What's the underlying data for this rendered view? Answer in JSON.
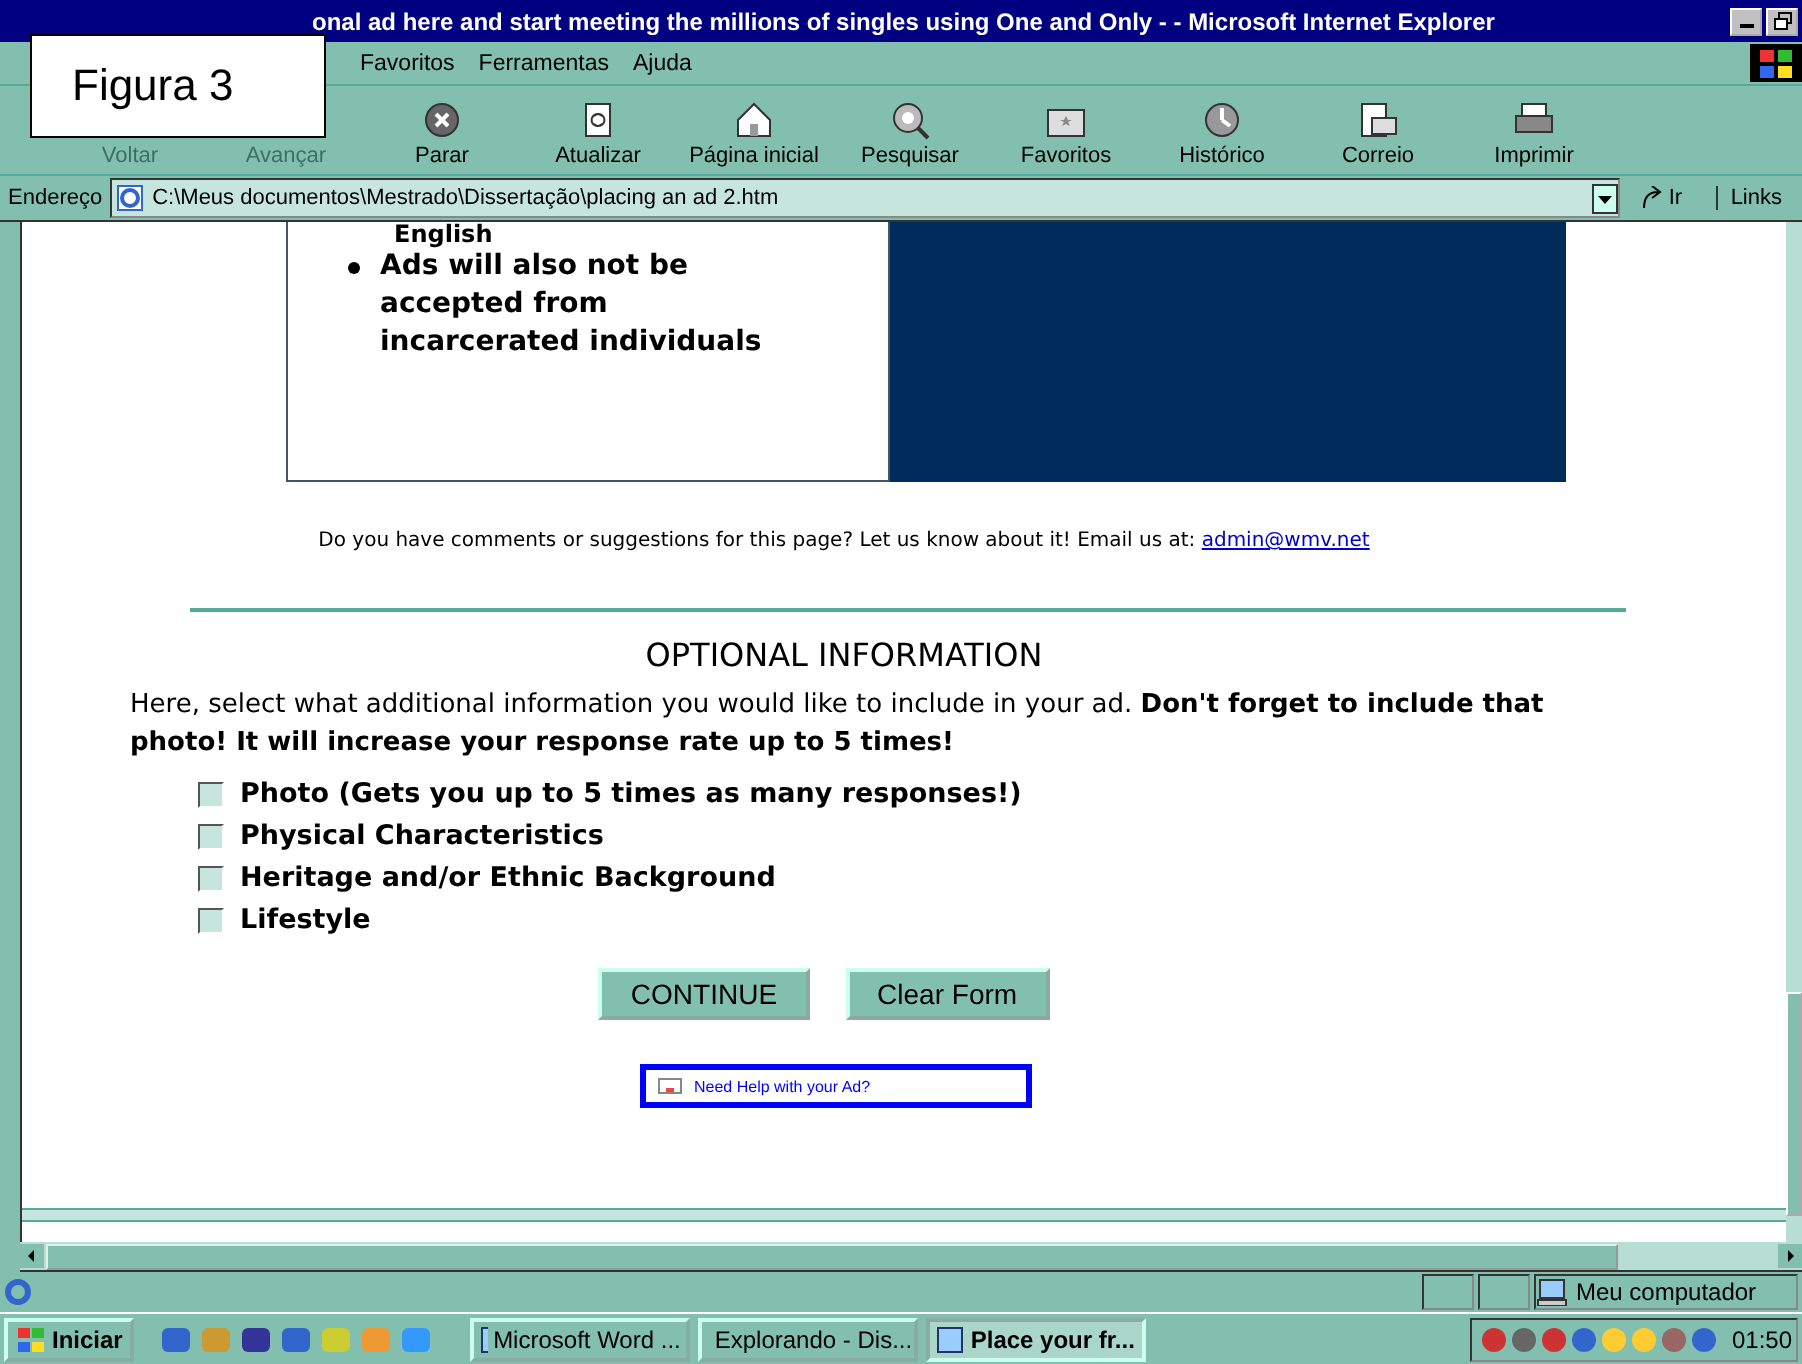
{
  "window": {
    "title": "onal ad here and start meeting the millions of singles using One and Only - - Microsoft Internet Explorer"
  },
  "overlay_label": "Figura 3",
  "menu": [
    "Favoritos",
    "Ferramentas",
    "Ajuda"
  ],
  "toolbar": [
    {
      "label": "Voltar",
      "disabled": true
    },
    {
      "label": "Avançar",
      "disabled": true
    },
    {
      "label": "Parar",
      "disabled": false
    },
    {
      "label": "Atualizar",
      "disabled": false
    },
    {
      "label": "Página inicial",
      "disabled": false
    },
    {
      "label": "Pesquisar",
      "disabled": false
    },
    {
      "label": "Favoritos",
      "disabled": false
    },
    {
      "label": "Histórico",
      "disabled": false
    },
    {
      "label": "Correio",
      "disabled": false
    },
    {
      "label": "Imprimir",
      "disabled": false
    }
  ],
  "address_bar": {
    "label": "Endereço",
    "value": "C:\\Meus documentos\\Mestrado\\Dissertação\\placing an ad 2.htm",
    "go": "Ir",
    "links": "Links"
  },
  "page": {
    "bullet_tail": "English",
    "bullet": "Ads will also not be accepted from incarcerated individuals",
    "comments": "Do you have comments or suggestions for this page? Let us know about it! Email us at: ",
    "email": "admin@wmv.net",
    "heading": "OPTIONAL INFORMATION",
    "intro": "Here, select what additional information you would like to include in your ad. **Don't forget to include that photo! It will increase your response rate up to 5 times!**",
    "options": [
      {
        "label": "Photo (Gets you up to 5 times as many responses!)",
        "checked": false
      },
      {
        "label": "Physical Characteristics",
        "checked": false
      },
      {
        "label": "Heritage and/or Ethnic Background",
        "checked": false
      },
      {
        "label": "Lifestyle",
        "checked": false
      }
    ],
    "buttons": [
      "CONTINUE",
      "Clear Form"
    ],
    "help_link": "Need Help with your Ad?"
  },
  "status_bar": {
    "zone": "Meu computador"
  },
  "taskbar": {
    "start": "Iniciar",
    "tasks": [
      {
        "label": "Microsoft Word ...",
        "selected": false
      },
      {
        "label": "Explorando - Dis...",
        "selected": false
      },
      {
        "label": "Place your fr...",
        "selected": true
      }
    ],
    "clock": "01:50"
  }
}
